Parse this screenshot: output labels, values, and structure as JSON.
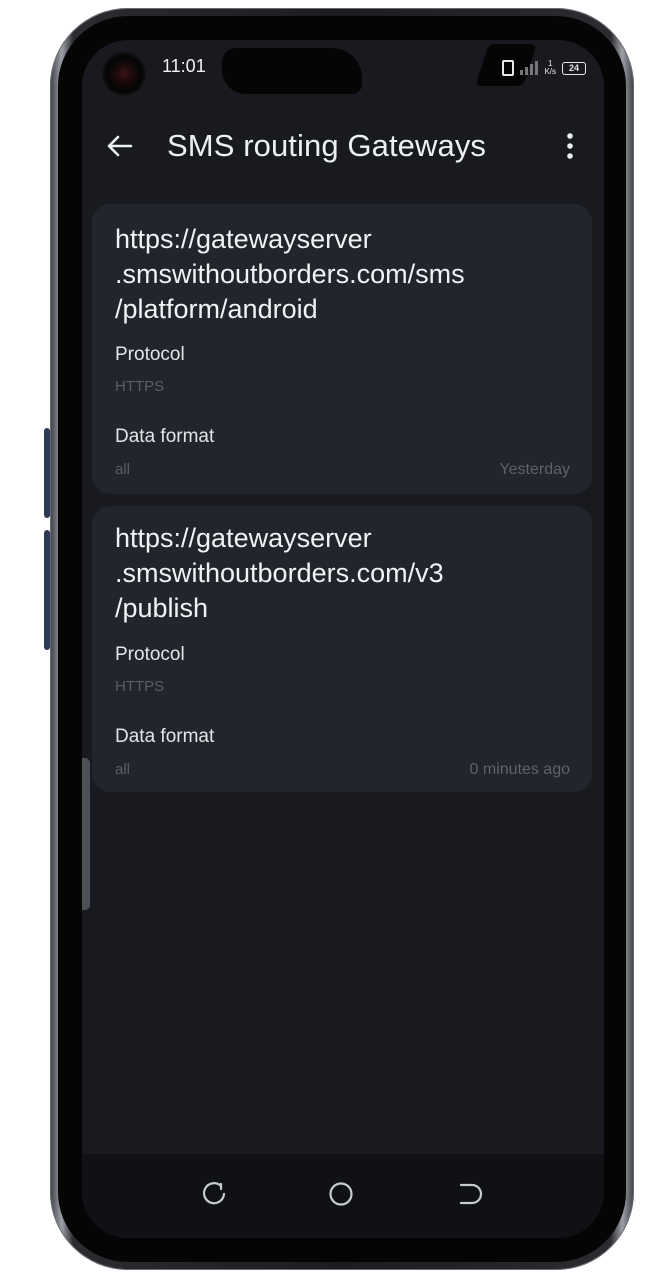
{
  "status_bar": {
    "time": "11:01",
    "network_speed_value": "1",
    "network_speed_unit": "K/s",
    "battery_level": "24"
  },
  "app_bar": {
    "title": "SMS routing Gateways",
    "back_icon": "arrow-left-icon",
    "menu_icon": "more-vert-icon"
  },
  "gateways": [
    {
      "url_lines": [
        "https://gatewayserver",
        ".smswithoutborders.com/sms",
        "/platform/android"
      ],
      "protocol_label": "Protocol",
      "protocol_value": "HTTPS",
      "data_format_label": "Data format",
      "data_format_value": "all",
      "timestamp": "Yesterday"
    },
    {
      "url_lines": [
        "https://gatewayserver",
        ".smswithoutborders.com/v3",
        "/publish"
      ],
      "protocol_label": "Protocol",
      "protocol_value": "HTTPS",
      "data_format_label": "Data format",
      "data_format_value": "all",
      "timestamp": "0 minutes ago"
    }
  ],
  "nav_bar": {
    "recents_icon": "recents-icon",
    "home_icon": "home-circle-icon",
    "back_icon": "nav-back-icon"
  },
  "colors": {
    "screen_background": "#181a1f",
    "card_background": "#22252b",
    "text_primary": "#f0f2f5",
    "text_muted": "#5a5e66"
  }
}
